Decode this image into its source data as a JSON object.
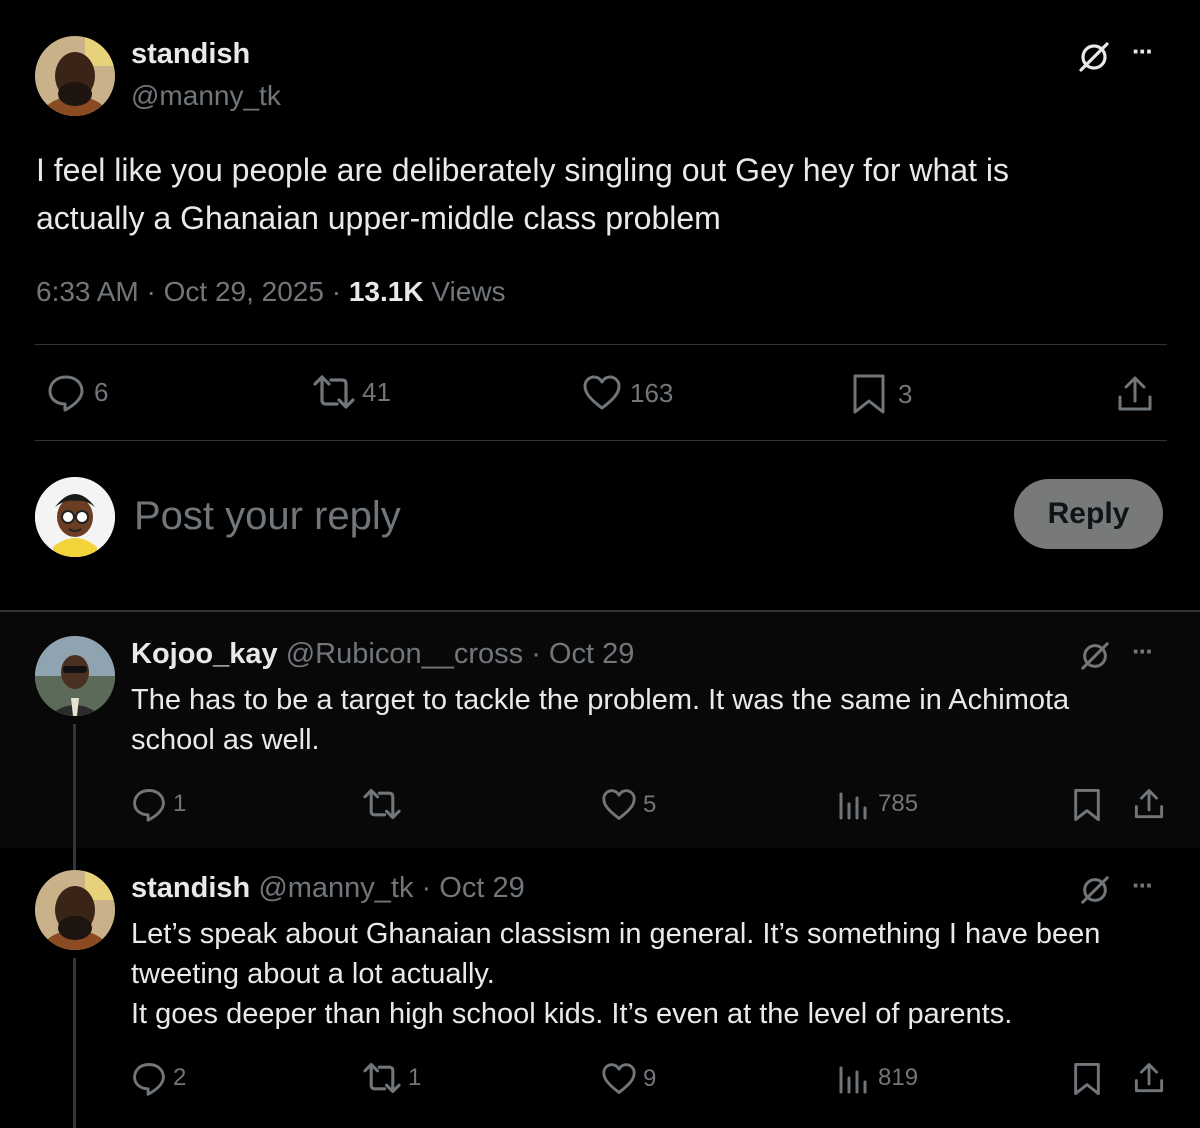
{
  "main_post": {
    "display_name": "standish",
    "handle": "@manny_tk",
    "text_line1": "I feel like you people are deliberately singling out Gey hey for what is",
    "text_line2": "actually a Ghanaian upper-middle class problem",
    "time": "6:33 AM",
    "sep": "·",
    "date": "Oct 29, 2025",
    "views_count": "13.1K",
    "views_label": "Views",
    "stats": {
      "replies": "6",
      "reposts": "41",
      "likes": "163",
      "bookmarks": "3"
    }
  },
  "composer": {
    "placeholder": "Post your reply",
    "button_label": "Reply"
  },
  "replies": [
    {
      "display_name": "Kojoo_kay",
      "handle": "@Rubicon__cross",
      "sep": "·",
      "date": "Oct 29",
      "lines": [
        "The has to be a target to tackle the problem. It was the same in Achimota",
        "school as well."
      ],
      "stats": {
        "replies": "1",
        "reposts": "",
        "likes": "5",
        "views": "785"
      }
    },
    {
      "display_name": "standish",
      "handle": "@manny_tk",
      "sep": "·",
      "date": "Oct 29",
      "lines": [
        "Let’s speak about Ghanaian classism in general. It’s something I have been",
        "tweeting about a lot actually.",
        "It goes deeper than high school kids. It’s even at the level of parents."
      ],
      "stats": {
        "replies": "2",
        "reposts": "1",
        "likes": "9",
        "views": "819"
      }
    }
  ],
  "more_glyph": "···",
  "icons": {
    "grok": "grok-icon",
    "more": "more-icon",
    "reply": "reply-icon",
    "repost": "repost-icon",
    "like": "like-icon",
    "bookmark": "bookmark-icon",
    "share": "share-icon",
    "views": "views-icon"
  },
  "colors": {
    "background": "#000000",
    "reply_bg": "#080808",
    "text": "#e7e9ea",
    "secondary": "#71767b",
    "divider": "#2f3336",
    "reply_button_bg": "#787a7a"
  }
}
